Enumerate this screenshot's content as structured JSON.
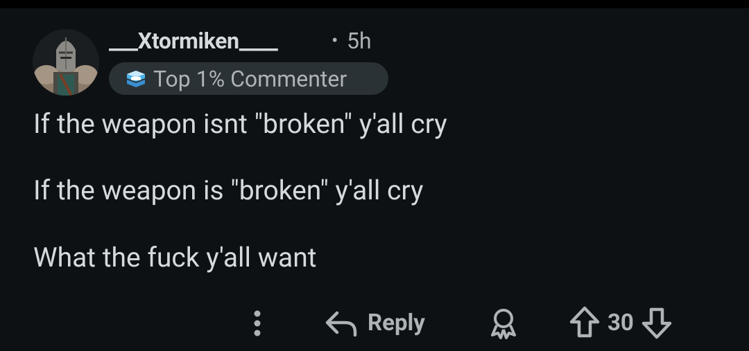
{
  "comment": {
    "author": "___Xtormiken____",
    "separator": "•",
    "age": "5h",
    "badge": {
      "label": "Top 1% Commenter",
      "icon": "commenter-badge-icon"
    },
    "body": [
      "If the weapon isnt \"broken\" y'all cry",
      "If the weapon is \"broken\" y'all cry",
      "What the fuck y'all want"
    ]
  },
  "actions": {
    "more_icon": "more-icon",
    "reply_label": "Reply",
    "reply_icon": "reply-arrow-icon",
    "award_icon": "award-icon",
    "upvote_icon": "upvote-arrow-icon",
    "vote_count": "30",
    "downvote_icon": "downvote-arrow-icon"
  },
  "colors": {
    "background": "#0e1113",
    "text_primary": "#d7dadc",
    "text_secondary": "#aeb3b7",
    "badge_background": "#2a3236",
    "badge_accent": "#47b4e8"
  }
}
